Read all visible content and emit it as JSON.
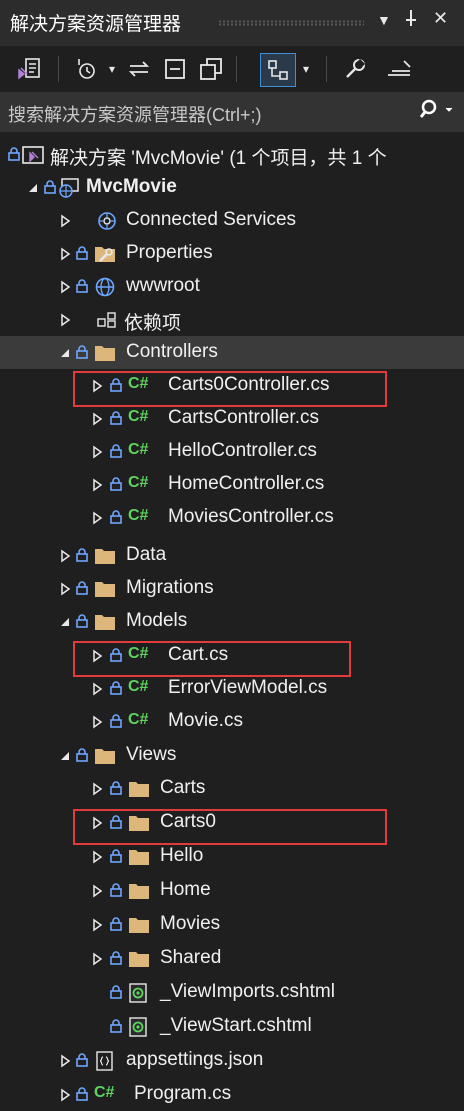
{
  "window": {
    "title": "解决方案资源管理器",
    "pin_glyph": "▼",
    "dock_glyph": "⊥",
    "close_glyph": "✕"
  },
  "search": {
    "placeholder": "搜索解决方案资源管理器(Ctrl+;)",
    "icon": "search-icon"
  },
  "colors": {
    "background": "#1f1f1f",
    "selected_row": "#3b3b3b",
    "csharp": "#5fd35f",
    "folder": "#dcb67a",
    "lock": "#6ea6ff",
    "highlight_box": "#e23b3b"
  },
  "tree": {
    "solution": "解决方案 'MvcMovie' (1 个项目，共 1 个",
    "project": "MvcMovie",
    "connected_services": "Connected Services",
    "properties": "Properties",
    "wwwroot": "wwwroot",
    "dependencies": "依赖项",
    "controllers": "Controllers",
    "carts0_controller": "Carts0Controller.cs",
    "carts_controller": "CartsController.cs",
    "hello_controller": "HelloController.cs",
    "home_controller": "HomeController.cs",
    "movies_controller": "MoviesController.cs",
    "data": "Data",
    "migrations": "Migrations",
    "models": "Models",
    "cart_model": "Cart.cs",
    "error_view_model": "ErrorViewModel.cs",
    "movie_model": "Movie.cs",
    "views": "Views",
    "views_carts": "Carts",
    "views_carts0": "Carts0",
    "views_hello": "Hello",
    "views_home": "Home",
    "views_movies": "Movies",
    "views_shared": "Shared",
    "view_imports": "_ViewImports.cshtml",
    "view_start": "_ViewStart.cshtml",
    "appsettings": "appsettings.json",
    "program": "Program.cs",
    "csharp_tag": "C#"
  }
}
